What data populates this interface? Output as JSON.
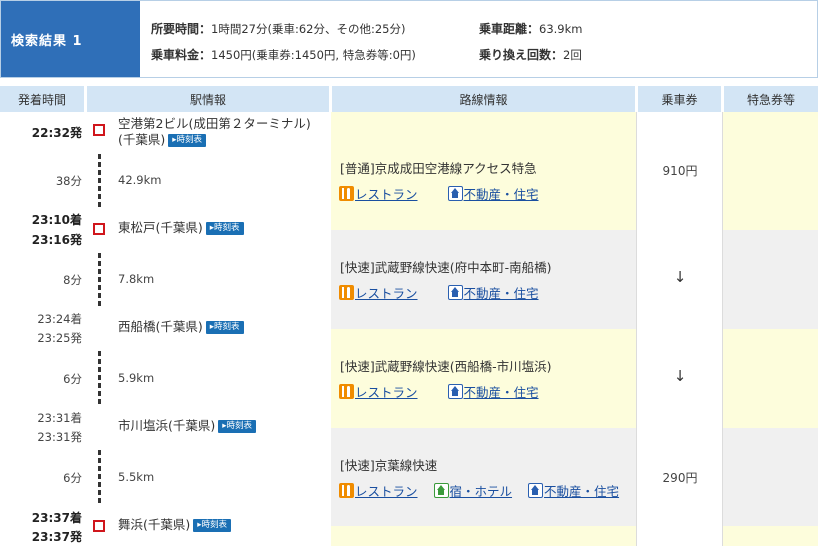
{
  "summary": {
    "label": "検索結果 1",
    "duration_key": "所要時間：",
    "duration_val": "1時間27分(乗車:62分、その他:25分)",
    "distance_key": "乗車距離：",
    "distance_val": "63.9km",
    "fare_key": "乗車料金：",
    "fare_val": "1450円(乗車券:1450円, 特急券等:0円)",
    "transfers_key": "乗り換え回数：",
    "transfers_val": "2回"
  },
  "headers": {
    "time": "発着時間",
    "station": "駅情報",
    "route": "路線情報",
    "ticket": "乗車券",
    "express": "特急券等"
  },
  "timetable_label": "時刻表",
  "stations": [
    {
      "name_line1": "空港第2ビル(成田第２ターミナル)",
      "name_line2": "(千葉県)",
      "time1": "22:32発",
      "time2": ""
    },
    {
      "name_line1": "東松戸(千葉県)",
      "time1": "23:10着",
      "time2": "23:16発"
    },
    {
      "name_line1": "西船橋(千葉県)",
      "time1": "23:24着",
      "time2": "23:25発"
    },
    {
      "name_line1": "市川塩浜(千葉県)",
      "time1": "23:31着",
      "time2": "23:31発"
    },
    {
      "name_line1": "舞浜(千葉県)",
      "time1": "23:37着",
      "time2": "23:37発"
    }
  ],
  "segments": [
    {
      "duration": "38分",
      "distance": "42.9km",
      "route": "[普通]京成成田空港線アクセス特急",
      "links": {
        "restaurant": "レストラン",
        "realestate": "不動産・住宅"
      },
      "fare": "910円"
    },
    {
      "duration": "8分",
      "distance": "7.8km",
      "route": "[快速]武蔵野線快速(府中本町-南船橋)",
      "links": {
        "restaurant": "レストラン",
        "realestate": "不動産・住宅"
      },
      "fare": "↓"
    },
    {
      "duration": "6分",
      "distance": "5.9km",
      "route": "[快速]武蔵野線快速(西船橋-市川塩浜)",
      "links": {
        "restaurant": "レストラン",
        "realestate": "不動産・住宅"
      },
      "fare": "↓"
    },
    {
      "duration": "6分",
      "distance": "5.5km",
      "route": "[快速]京葉線快速",
      "links": {
        "restaurant": "レストラン",
        "hotel": "宿・ホテル",
        "realestate": "不動産・住宅"
      },
      "fare": "290円"
    }
  ],
  "colors": {
    "summary_label_bg": "#2f6fb8",
    "header_bg": "#d3e5f5",
    "station_mark": "#d0161c",
    "timetable_button": "#1a6fb4",
    "link": "#1a4fa0",
    "band_yellow": "#fdfddc",
    "band_gray": "#f0f0f0"
  }
}
